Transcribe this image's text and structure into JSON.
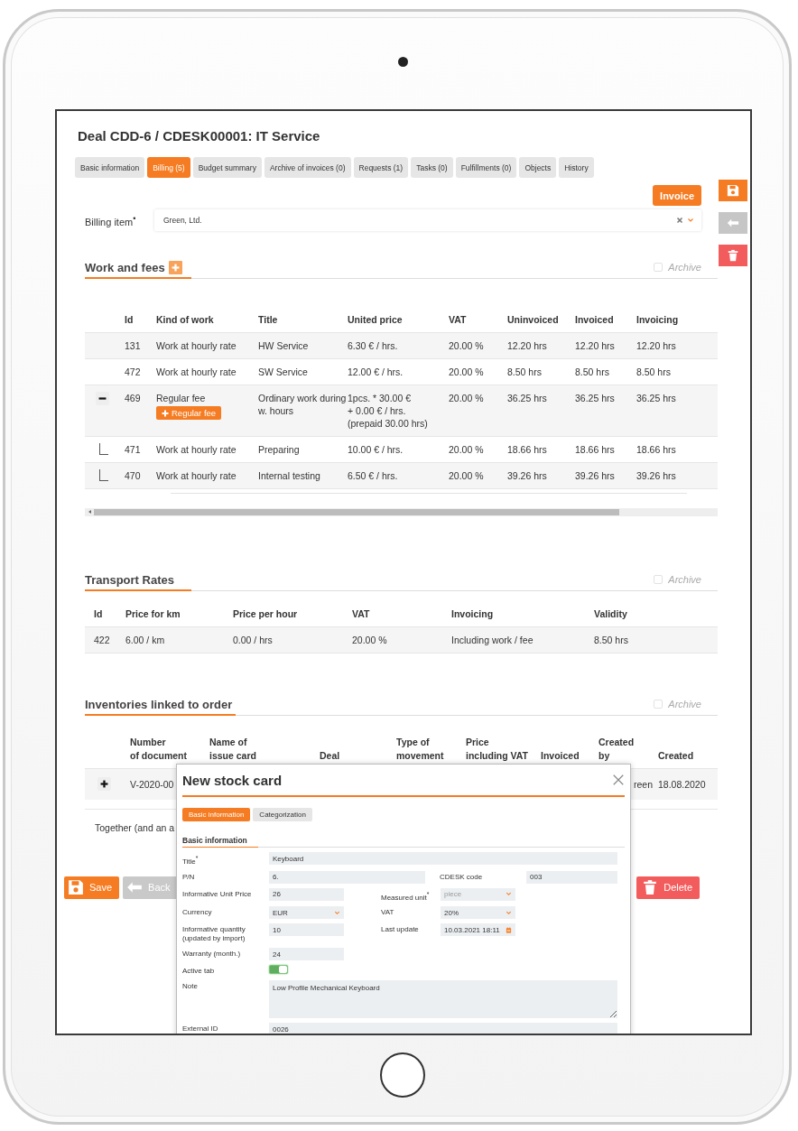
{
  "page": {
    "title": "Deal CDD-6 / CDESK00001: IT Service"
  },
  "tabs": [
    {
      "label": "Basic information",
      "selected": false
    },
    {
      "label": "Billing (5)",
      "selected": true
    },
    {
      "label": "Budget summary",
      "selected": false
    },
    {
      "label": "Archive of invoices (0)",
      "selected": false
    },
    {
      "label": "Requests (1)",
      "selected": false
    },
    {
      "label": "Tasks (0)",
      "selected": false
    },
    {
      "label": "Fulfillments (0)",
      "selected": false
    },
    {
      "label": "Objects",
      "selected": false
    },
    {
      "label": "History",
      "selected": false
    }
  ],
  "side_actions": [
    {
      "kind": "save"
    },
    {
      "kind": "back"
    },
    {
      "kind": "delete"
    }
  ],
  "invoice_button": "Invoice",
  "billing_item": {
    "label": "Billing item$^{•}$",
    "value": "Green, Ltd."
  },
  "work_and_fees": {
    "title": "Work and fees",
    "archive": {
      "label": "Archive",
      "checked": false
    },
    "columns": [
      "Id",
      "Kind of work",
      "Title",
      "United price",
      "VAT",
      "Uninvoiced",
      "Invoiced",
      "Invoicing"
    ],
    "rows": [
      {
        "cells": [
          "131",
          "Work at hourly rate",
          "HW Service",
          "6.30 € / hrs.",
          "20.00 %",
          "12.20 hrs",
          "12.20 hrs",
          "12.20 hrs"
        ]
      },
      {
        "cells": [
          "472",
          "Work at hourly rate",
          "SW Service",
          "12.00 € / hrs.",
          "20.00 %",
          "8.50 hrs",
          "8.50 hrs",
          "8.50 hrs"
        ]
      },
      {
        "cells": [
          "469",
          "Regular fee",
          "Ordinary work during w. hours",
          "1pcs. * 30.00 €\n+ 0.00 € / hrs.\n(prepaid 30.00 hrs)",
          "20.00 %",
          "36.25 hrs",
          "36.25 hrs",
          "36.25 hrs"
        ],
        "add_button": "Regular fee",
        "expanded": true,
        "children": [
          {
            "cells": [
              "471",
              "Work at hourly rate",
              "Preparing",
              "10.00 € / hrs.",
              "20.00 %",
              "18.66 hrs",
              "18.66 hrs",
              "18.66 hrs"
            ]
          },
          {
            "cells": [
              "470",
              "Work at hourly rate",
              "Internal testing",
              "6.50 € / hrs.",
              "20.00 %",
              "39.26 hrs",
              "39.26 hrs",
              "39.26 hrs"
            ]
          }
        ]
      }
    ]
  },
  "transport_rates": {
    "title": "Transport Rates",
    "archive": {
      "label": "Archive",
      "checked": false
    },
    "columns": [
      "Id",
      "Price for km",
      "Price per hour",
      "VAT",
      "Invoicing",
      "Validity"
    ],
    "rows": [
      {
        "cells": [
          "422",
          "6.00 / km",
          "0.00 / hrs",
          "20.00 %",
          "Including work / fee",
          "8.50 hrs"
        ]
      }
    ]
  },
  "inventories": {
    "title": "Inventories linked to order",
    "archive": {
      "label": "Archive",
      "checked": false
    },
    "columns": [
      "Number\nof document",
      "Name of\nissue card",
      "Deal",
      "Type of\nmovement",
      "Price\nincluding VAT",
      "Invoiced",
      "Created\nby",
      "Created"
    ],
    "rows": [
      {
        "expanded": false,
        "number_of_document": "V-2020-00",
        "created_by": "reen",
        "created": "18.08.2020"
      }
    ],
    "footer": "Together (and an a"
  },
  "bottom_buttons": [
    {
      "kind": "save",
      "label": "Save"
    },
    {
      "kind": "back",
      "label": "Back"
    },
    {
      "kind": "delete",
      "label": "Delete"
    }
  ],
  "modal": {
    "title": "New stock card",
    "tabs": [
      {
        "label": "Basic information",
        "selected": true
      },
      {
        "label": "Categorization",
        "selected": false
      }
    ],
    "section": "Basic information",
    "rows": [
      {
        "kind": "full",
        "fields": [
          {
            "kind": "text",
            "label": "Title$^{*}$",
            "value": "Keyboard"
          }
        ]
      },
      {
        "kind": "split",
        "fields": [
          {
            "kind": "text",
            "label": "P/N",
            "value": "6."
          },
          {
            "kind": "text",
            "label": "CDESK code",
            "value": "003"
          }
        ]
      },
      {
        "kind": "double",
        "fields": [
          {
            "kind": "text",
            "label": "Informative Unit Price",
            "value": "26"
          },
          {
            "kind": "select",
            "label": "Measured unit$^{*}$",
            "placeholder": "piece"
          }
        ]
      },
      {
        "kind": "double",
        "fields": [
          {
            "kind": "select",
            "label": "Currency",
            "value": "EUR"
          },
          {
            "kind": "select",
            "label": "VAT",
            "value": "20%"
          }
        ]
      },
      {
        "kind": "double",
        "fields": [
          {
            "kind": "text",
            "label": "Informative quantity (updated by import)",
            "value": "10"
          },
          {
            "kind": "date",
            "label": "Last update",
            "value": "10.03.2021 18:11"
          }
        ]
      },
      {
        "kind": "double",
        "fields": [
          {
            "kind": "text",
            "label": "Warranty (month.)",
            "value": "24"
          }
        ]
      },
      {
        "kind": "double",
        "fields": [
          {
            "kind": "toggle",
            "label": "Active tab",
            "on": true
          }
        ]
      },
      {
        "kind": "full",
        "fields": [
          {
            "kind": "textarea",
            "label": "Note",
            "value": "Low Profile Mechanical Keyboard"
          }
        ]
      },
      {
        "kind": "full",
        "fields": [
          {
            "kind": "text",
            "label": "External ID",
            "value": "0026"
          }
        ]
      }
    ]
  }
}
